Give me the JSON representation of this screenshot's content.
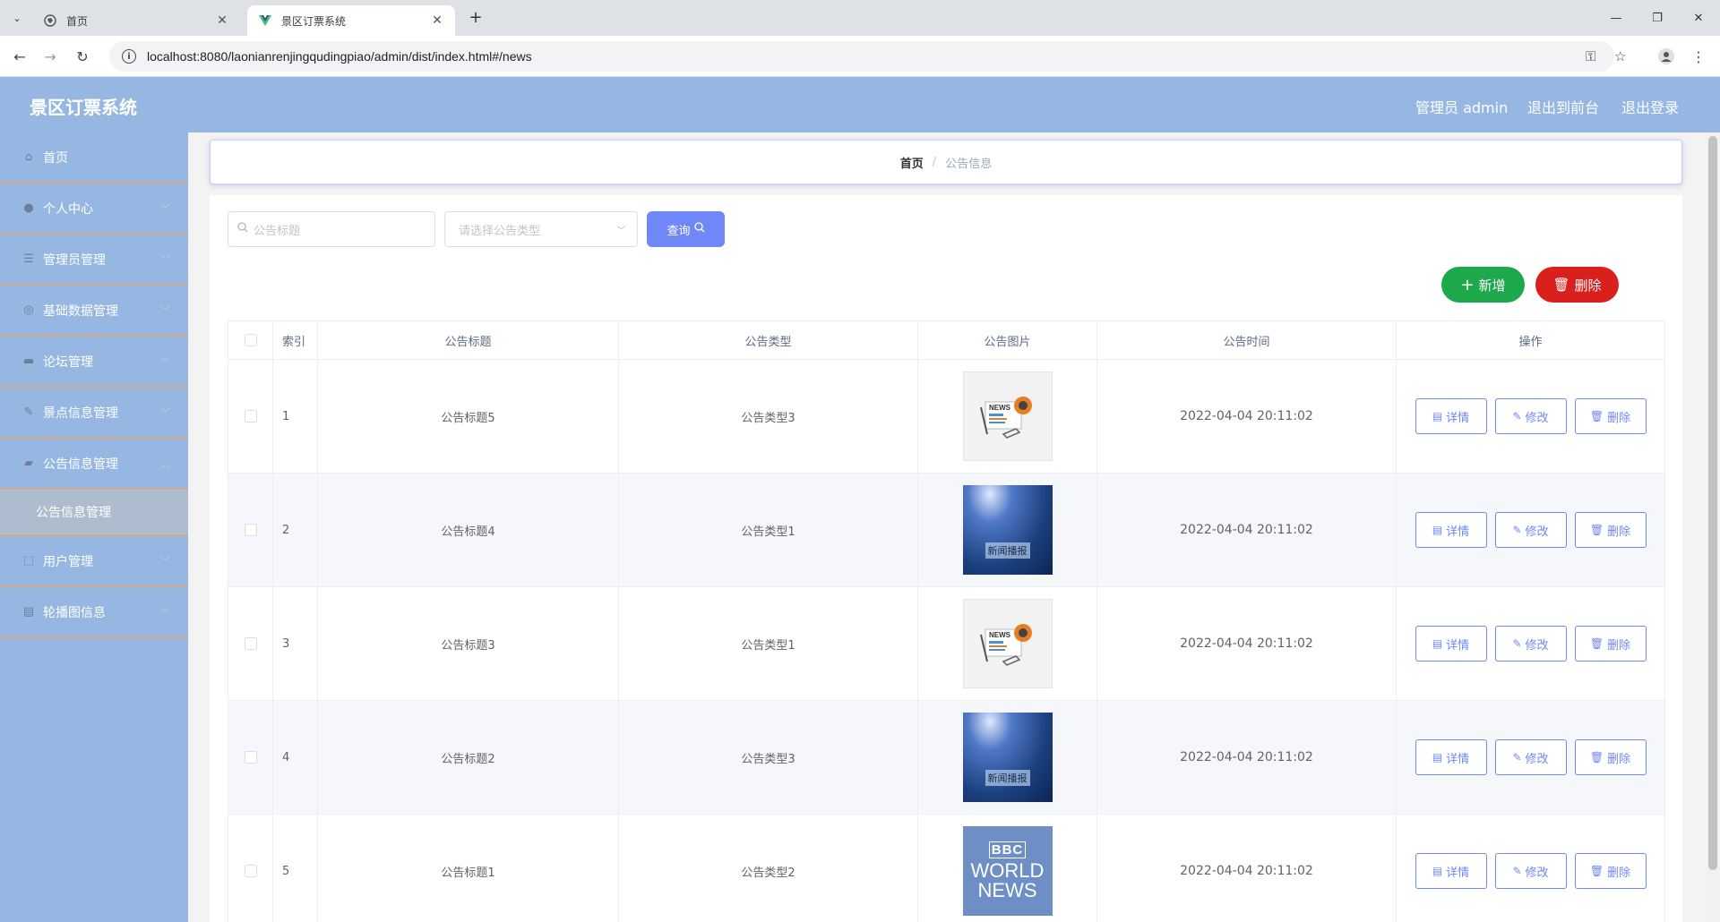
{
  "browser": {
    "tabs": [
      {
        "title": "首页",
        "active": false
      },
      {
        "title": "景区订票系统",
        "active": true
      }
    ],
    "new_tab": "+",
    "url": "localhost:8080/laonianrenjingqudingpiao/admin/dist/index.html#/news"
  },
  "header": {
    "title": "景区订票系统",
    "user": "管理员 admin",
    "to_front": "退出到前台",
    "logout": "退出登录"
  },
  "sidebar": {
    "items": [
      {
        "label": "首页",
        "icon": "home-icon"
      },
      {
        "label": "个人中心",
        "icon": "user-icon"
      },
      {
        "label": "管理员管理",
        "icon": "sliders-icon"
      },
      {
        "label": "基础数据管理",
        "icon": "globe-icon"
      },
      {
        "label": "论坛管理",
        "icon": "forum-icon"
      },
      {
        "label": "景点信息管理",
        "icon": "scenic-icon"
      },
      {
        "label": "公告信息管理",
        "icon": "notice-icon"
      },
      {
        "label": "用户管理",
        "icon": "users-icon"
      },
      {
        "label": "轮播图信息",
        "icon": "carousel-icon"
      }
    ],
    "submenu": {
      "label": "公告信息管理"
    }
  },
  "breadcrumb": {
    "home": "首页",
    "separator": "/",
    "current": "公告信息"
  },
  "search": {
    "title_placeholder": "公告标题",
    "type_placeholder": "请选择公告类型",
    "query_label": "查询"
  },
  "actions": {
    "add_label": "新增",
    "delete_label": "删除"
  },
  "table": {
    "headers": {
      "index": "索引",
      "title": "公告标题",
      "type": "公告类型",
      "image": "公告图片",
      "time": "公告时间",
      "ops": "操作"
    },
    "ops": {
      "detail": "详情",
      "edit": "修改",
      "delete": "删除"
    },
    "rows": [
      {
        "index": "1",
        "title": "公告标题5",
        "type": "公告类型3",
        "image": "news-image",
        "time": "2022-04-04 20:11:02"
      },
      {
        "index": "2",
        "title": "公告标题4",
        "type": "公告类型1",
        "image": "stage-image",
        "image_text": "新闻播报",
        "time": "2022-04-04 20:11:02"
      },
      {
        "index": "3",
        "title": "公告标题3",
        "type": "公告类型1",
        "image": "news-image",
        "time": "2022-04-04 20:11:02"
      },
      {
        "index": "4",
        "title": "公告标题2",
        "type": "公告类型3",
        "image": "stage-image",
        "image_text": "新闻播报",
        "time": "2022-04-04 20:11:02"
      },
      {
        "index": "5",
        "title": "公告标题1",
        "type": "公告类型2",
        "image": "bbc-image",
        "time": "2022-04-04 20:11:02"
      }
    ],
    "bbc_text": {
      "line1": "BBC",
      "line2": "WORLD",
      "line3": "NEWS"
    }
  },
  "colors": {
    "header_bg": "#95b7e2",
    "accent": "#6f87f7",
    "add_btn": "#1ea84c",
    "delete_btn": "#d9201d"
  }
}
